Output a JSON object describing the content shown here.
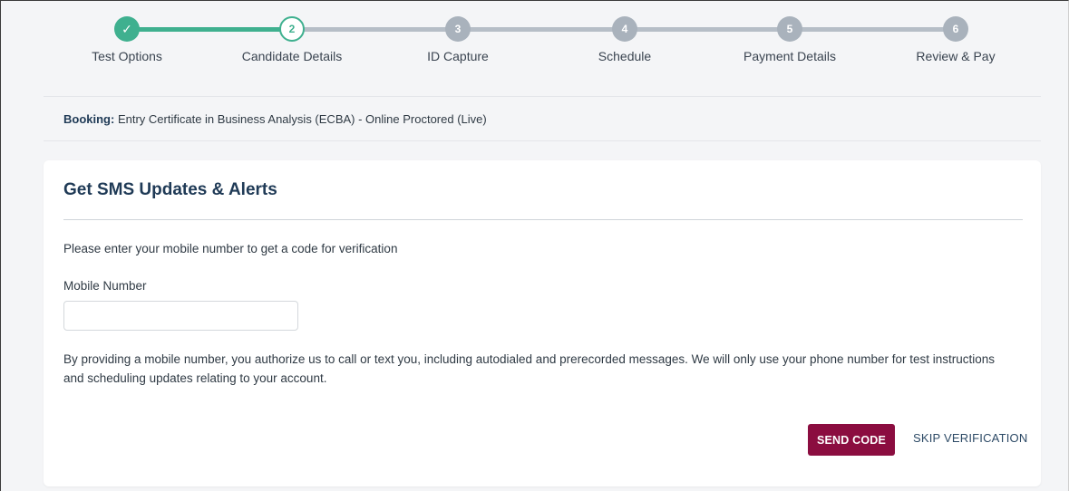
{
  "stepper": {
    "steps": [
      {
        "label": "Test Options",
        "marker": "✓",
        "state": "completed",
        "icon": "check-icon"
      },
      {
        "label": "Candidate Details",
        "marker": "2",
        "state": "current"
      },
      {
        "label": "ID Capture",
        "marker": "3",
        "state": "upcoming"
      },
      {
        "label": "Schedule",
        "marker": "4",
        "state": "upcoming"
      },
      {
        "label": "Payment Details",
        "marker": "5",
        "state": "upcoming"
      },
      {
        "label": "Review & Pay",
        "marker": "6",
        "state": "upcoming"
      }
    ],
    "colors": {
      "completed": "#3fb08f",
      "upcoming": "#a9b2bc"
    }
  },
  "booking": {
    "label": "Booking:",
    "value": "Entry Certificate in Business Analysis (ECBA) - Online Proctored (Live)"
  },
  "sms_card": {
    "title": "Get SMS Updates & Alerts",
    "instruction": "Please enter your mobile number to get a code for verification",
    "mobile_label": "Mobile Number",
    "mobile_value": "",
    "mobile_placeholder": "",
    "disclaimer": "By providing a mobile number, you authorize us to call or text you, including autodialed and prerecorded messages. We will only use your phone number for test instructions and scheduling updates relating to your account.",
    "send_button": "SEND CODE",
    "skip_link": "SKIP VERIFICATION",
    "send_button_color": "#8b0d40"
  }
}
